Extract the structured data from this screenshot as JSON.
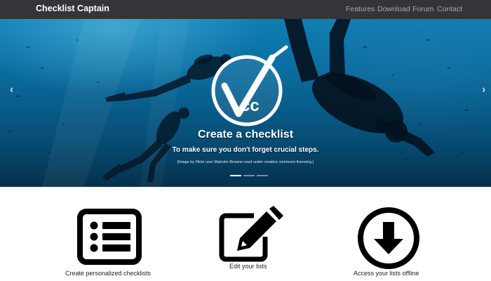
{
  "navbar": {
    "brand": "Checklist Captain",
    "links": [
      "Features",
      "Download",
      "Forum",
      "Contact"
    ]
  },
  "carousel": {
    "caption": {
      "title": "Create a checklist",
      "subtitle": "To make sure you don't forget crucial steps.",
      "credit": "[Image by Flickr user Malcolm Browne used under creative commons licensing.]"
    },
    "slide_count": 3,
    "active_slide": 0
  },
  "features": [
    {
      "label": "Create personalized checklists",
      "icon": "list-icon"
    },
    {
      "label": "Edit your lists",
      "icon": "edit-icon"
    },
    {
      "label": "Access your lists offline",
      "icon": "download-icon"
    }
  ],
  "colors": {
    "navbar_bg": "#333538",
    "nav_link": "#a9a9a9",
    "ocean_top": "#0f7fb4",
    "ocean_bottom": "#04314c"
  }
}
